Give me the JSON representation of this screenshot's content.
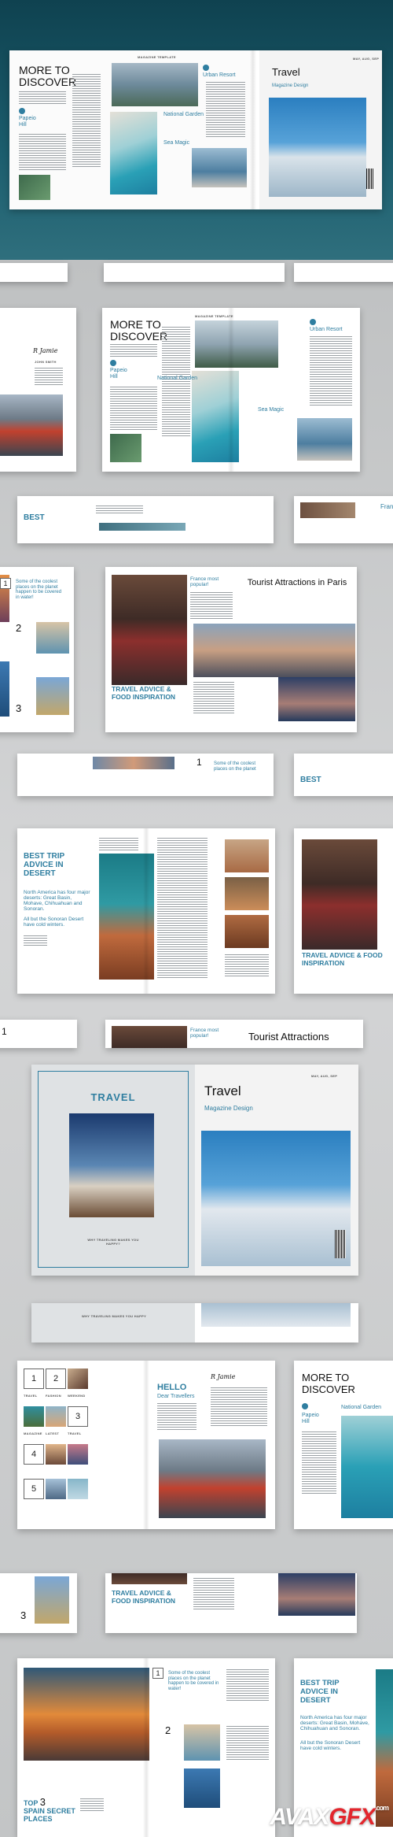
{
  "spread1": {
    "header": "MAGAZINE TEMPLATE",
    "title_line1": "MORE TO",
    "title_line2": "DISCOVER",
    "lbl_urban": "Urban Resort",
    "lbl_papeio": "Papeio",
    "lbl_hill": "Hill",
    "lbl_garden": "National Garden",
    "lbl_sea": "Sea Magic",
    "cover_title": "Travel",
    "cover_sub": "Magazine Design",
    "cover_date": "MAY, AUG, SEP"
  },
  "spread2": {
    "signature": "R Jamie",
    "name": "JOHN SMITH",
    "title_line1": "MORE TO",
    "title_line2": "DISCOVER",
    "lbl_urban": "Urban Resort",
    "lbl_papeio": "Papeio",
    "lbl_hill": "Hill",
    "lbl_garden": "National Garden",
    "lbl_sea": "Sea Magic"
  },
  "strip1": {
    "best": "BEST",
    "france": "France"
  },
  "spread3": {
    "coolest": "Some of the coolest places on the planet happen to be covered in water!",
    "n2": "2",
    "n3": "3",
    "france_pop": "France most popular!",
    "tourist_title": "Tourist Attractions in Paris",
    "travel_advice": "TRAVEL ADVICE & FOOD INSPIRATION"
  },
  "strip2": {
    "n1": "1",
    "coolest": "Some of the coolest places on the planet",
    "best": "BEST"
  },
  "spread4": {
    "best_title": "BEST TRIP ADVICE IN DESERT",
    "desert_text": "North America has four major deserts: Great Basin, Mohave, Chihuahuan and Sonoran.",
    "sonoran": "All but the Sonoran Desert have cold winters.",
    "travel_advice": "TRAVEL ADVICE & FOOD INSPIRATION"
  },
  "strip3": {
    "n1": "1",
    "france_pop": "France most popular!",
    "tourist": "Tourist Attractions"
  },
  "spread5": {
    "travel_left": "TRAVEL",
    "why": "WHY TRAVELING MAKES YOU HAPPY?",
    "cover_title": "Travel",
    "cover_sub": "Magazine Design",
    "cover_date": "MAY, AUG, SEP"
  },
  "strip4": {
    "why": "WHY TRAVELING MAKES YOU HAPPY"
  },
  "spread6": {
    "n1": "1",
    "n2": "2",
    "n3": "3",
    "n4": "4",
    "n5": "5",
    "cap1": "TRAVEL",
    "cap2": "FASHION",
    "cap3": "WEEKEND",
    "cap4": "MAGAZINE",
    "cap5": "LATEST",
    "cap6": "TRAVEL",
    "hello": "HELLO",
    "dear": "Dear Travellers",
    "signature": "R Jamie",
    "more_to": "MORE TO",
    "discover": "DISCOVER",
    "papeio": "Papeio",
    "hill": "Hill",
    "garden": "National Garden"
  },
  "strip5": {
    "n3": "3",
    "travel_advice": "TRAVEL ADVICE & FOOD INSPIRATION"
  },
  "spread7": {
    "n1": "1",
    "n2": "2",
    "coolest": "Some of the coolest places on the planet happen to be covered in water!",
    "top3_a": "TOP",
    "top3_n": "3",
    "top3_b": "SPAIN SECRET PLACES",
    "best_title": "BEST TRIP ADVICE IN DESERT",
    "desert_text": "North America has four major deserts: Great Basin, Mohave, Chihuahuan and Sonoran.",
    "sonoran": "All but the Sonoran Desert have cold winters."
  },
  "watermark": {
    "part1": "AVAX",
    "part2": "GFX",
    "tld": ".com"
  }
}
